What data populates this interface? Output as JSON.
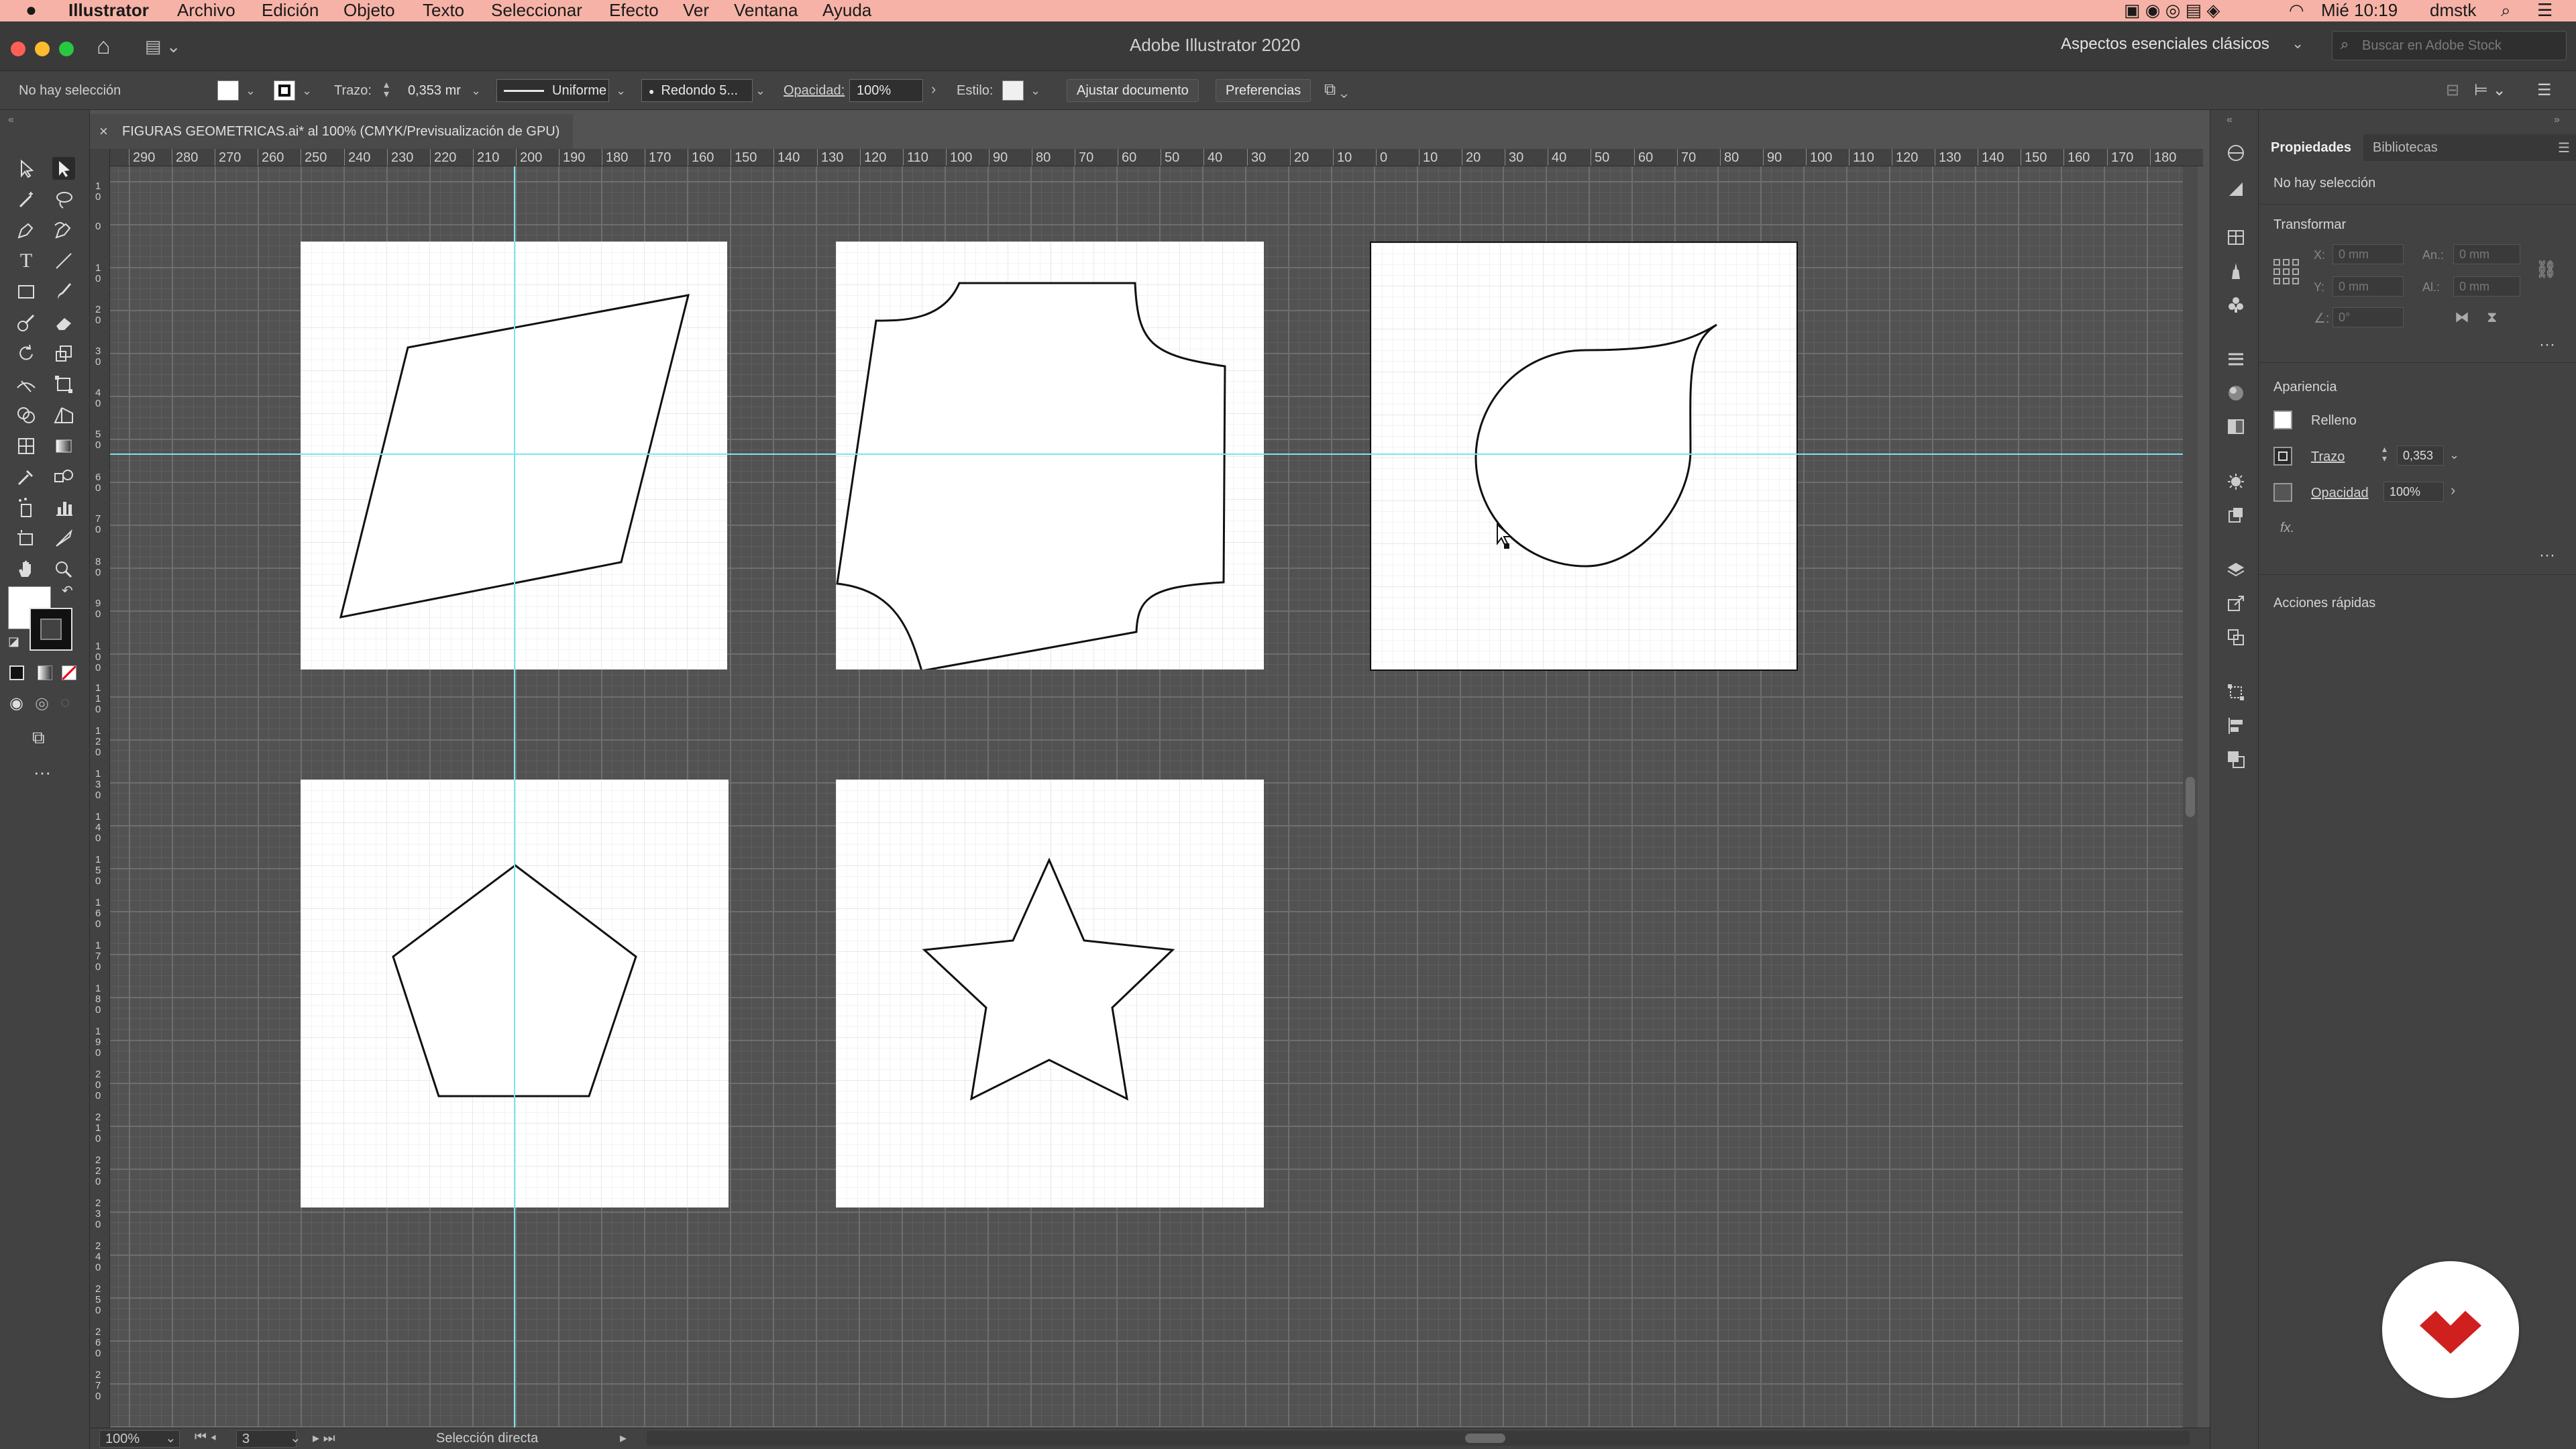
{
  "menubar": {
    "app_name": "Illustrator",
    "items": [
      "Archivo",
      "Edición",
      "Objeto",
      "Texto",
      "Seleccionar",
      "Efecto",
      "Ver",
      "Ventana",
      "Ayuda"
    ],
    "clock": "Mié 10:19",
    "user": "dmstk"
  },
  "titlebar": {
    "title": "Adobe Illustrator 2020",
    "workspace": "Aspectos esenciales clásicos",
    "search_placeholder": "Buscar en Adobe Stock"
  },
  "controlbar": {
    "selection_status": "No hay selección",
    "stroke_label": "Trazo:",
    "stroke_value": "0,353 mr",
    "profile": "Uniforme",
    "brush": "Redondo 5...",
    "opacity_label": "Opacidad:",
    "opacity_value": "100%",
    "style_label": "Estilo:",
    "fit_document_button": "Ajustar documento",
    "preferences_button": "Preferencias"
  },
  "document": {
    "tab_title": "FIGURAS GEOMETRICAS.ai* al 100% (CMYK/Previsualización de GPU)"
  },
  "ruler": {
    "labels": [
      "290",
      "280",
      "270",
      "260",
      "250",
      "240",
      "230",
      "220",
      "210",
      "200",
      "190",
      "180",
      "170",
      "160",
      "150",
      "140",
      "130",
      "120",
      "110",
      "100",
      "90",
      "80",
      "70",
      "60",
      "50",
      "40",
      "30",
      "20",
      "10",
      "0",
      "10",
      "20",
      "30",
      "40",
      "50",
      "60",
      "70",
      "80",
      "90",
      "100",
      "110",
      "120",
      "130",
      "140",
      "150",
      "160",
      "170",
      "180"
    ]
  },
  "statusbar": {
    "zoom": "100%",
    "artboard_number": "3",
    "tool_name": "Selección directa"
  },
  "properties_panel": {
    "tabs": [
      "Propiedades",
      "Bibliotecas"
    ],
    "selection_status": "No hay selección",
    "transform_title": "Transformar",
    "x_label": "X:",
    "y_label": "Y:",
    "width_label": "An.:",
    "height_label": "Al.:",
    "x_value": "0 mm",
    "y_value": "0 mm",
    "width_value": "0 mm",
    "height_value": "0 mm",
    "angle_value": "0°",
    "appearance_title": "Apariencia",
    "fill_label": "Relleno",
    "stroke_label": "Trazo",
    "stroke_value": "0,353",
    "opacity_label": "Opacidad",
    "opacity_value": "100%",
    "fx_label": "fx.",
    "quick_actions_title": "Acciones rápidas"
  },
  "colors": {
    "menubar_bg": "#f6b2a6",
    "guide": "#7ee4f0",
    "brand_red": "#d01f1f"
  }
}
